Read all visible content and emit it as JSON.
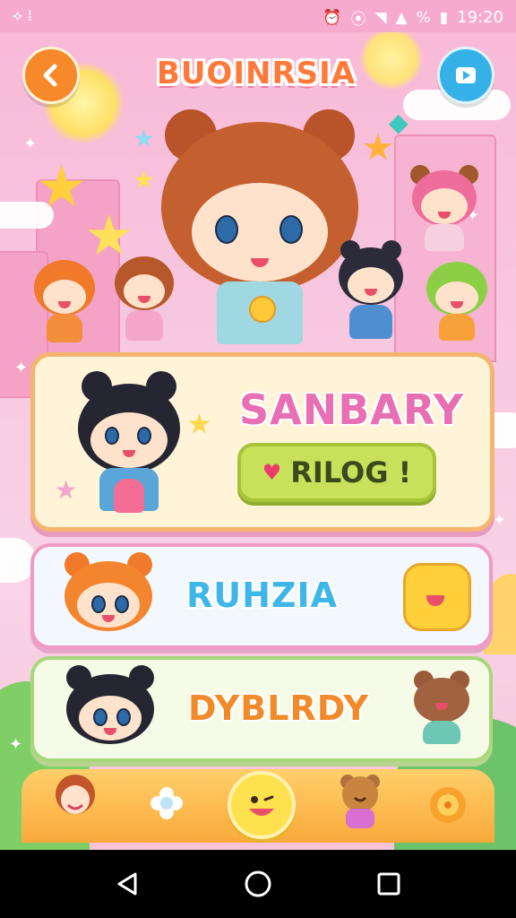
{
  "status_bar": {
    "left_icons": [
      "settings-icon",
      "vibrate-icon"
    ],
    "right_icons": [
      "alarm-icon",
      "silent-icon",
      "wifi-icon",
      "signal-icon"
    ],
    "battery_glyph": "%",
    "time": "19:20"
  },
  "header": {
    "title": "BUOINRSIA",
    "back_icon": "back-arrow-icon",
    "play_icon": "play-icon"
  },
  "cards": [
    {
      "title": "SANBARY",
      "button_label": "RILOG !",
      "button_icon": "heart-icon"
    },
    {
      "title": "RUHZIA"
    },
    {
      "title": "DYBLRDY"
    }
  ],
  "dock": {
    "items": [
      "boy-avatar-icon",
      "flower-icon",
      "smiley-icon",
      "bear-icon",
      "cookie-icon"
    ]
  },
  "nav": {
    "back": "nav-back-icon",
    "home": "nav-home-icon",
    "recents": "nav-recents-icon"
  },
  "colors": {
    "background": "#f7c7dd",
    "accent_orange": "#f7892b",
    "accent_blue": "#36b1e8",
    "button_green": "#c7e25a"
  }
}
